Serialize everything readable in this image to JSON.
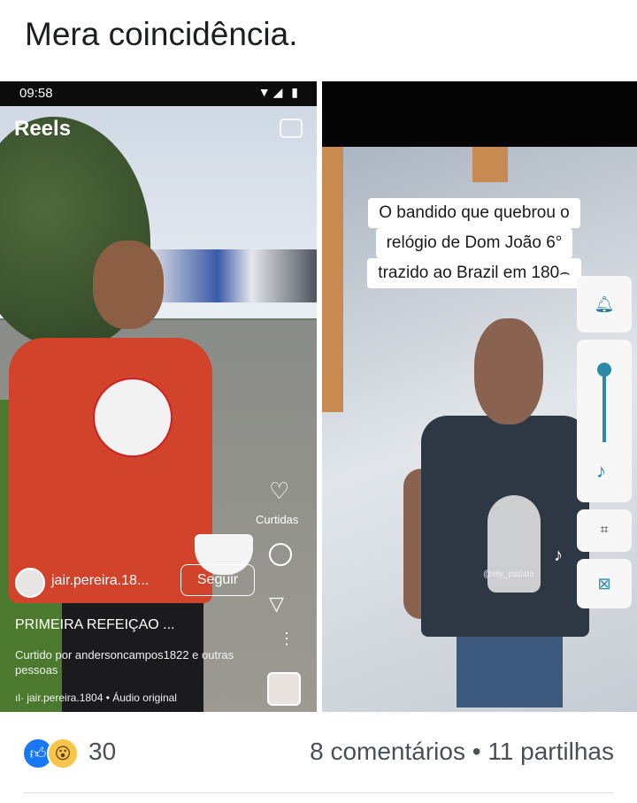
{
  "post": {
    "title": "Mera coincidência."
  },
  "reel": {
    "status_time": "09:58",
    "status_icons": "▼◢ ▮",
    "section_title": "Reels",
    "likes_label": "Curtidas",
    "username": "jair.pereira.18...",
    "follow_label": "Seguir",
    "caption": "PRIMEIRA REFEIÇAO ...",
    "liked_by": "Curtido por andersoncampos1822 e outras pessoas",
    "audio": "ıl· jair.pereira.1804 • Áudio original",
    "icons": [
      "camera-icon",
      "heart-icon",
      "comment-icon",
      "send-icon",
      "more-icon"
    ]
  },
  "tiktok": {
    "caption_lines": [
      "O bandido que quebrou o",
      "relógio de Dom João 6°",
      "trazido ao Brazil em 180⌢"
    ],
    "handle": "@ely_patista",
    "icons": [
      "bell-icon",
      "slider-icon",
      "music-note-icon",
      "grid-icon",
      "captions-icon",
      "tiktok-logo-icon"
    ]
  },
  "footer": {
    "reaction_count": "30",
    "engagement": "8 comentários • 11 partilhas",
    "colors": {
      "like": "#1877f2",
      "wow": "#f7c54a"
    }
  }
}
